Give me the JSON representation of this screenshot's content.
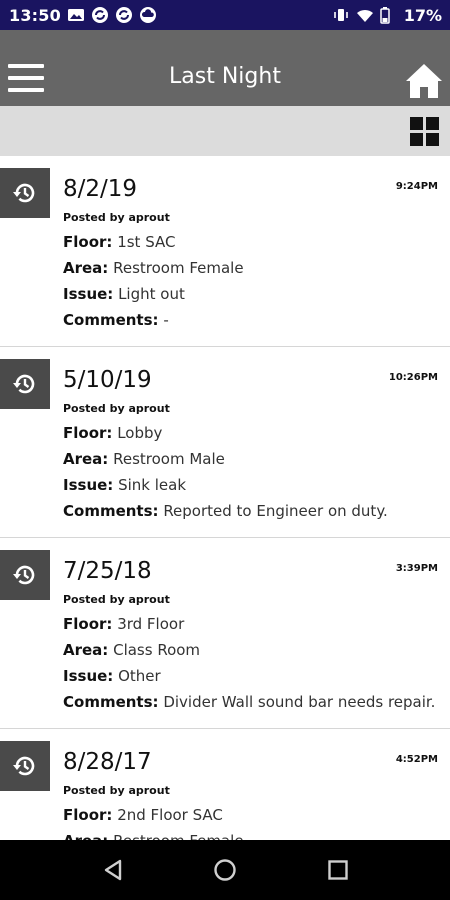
{
  "status": {
    "time": "13:50",
    "battery_percent": "17%",
    "left_icons": [
      "image-icon",
      "sync-icon",
      "sync-icon",
      "cloud-icon"
    ],
    "right_icons": [
      "vibrate-icon",
      "wifi-icon",
      "battery-icon"
    ]
  },
  "header": {
    "title": "Last Night",
    "menu_icon": "hamburger-menu-icon",
    "home_icon": "home-icon"
  },
  "toolbar": {
    "view_icon": "grid-view-icon"
  },
  "labels": {
    "floor": "Floor:",
    "area": "Area:",
    "issue": "Issue:",
    "comments": "Comments:"
  },
  "entries": [
    {
      "date": "8/2/19",
      "time": "9:24PM",
      "posted_by": "Posted by aprout",
      "floor": "1st SAC",
      "area": "Restroom Female",
      "issue": "Light out",
      "comments": "-"
    },
    {
      "date": "5/10/19",
      "time": "10:26PM",
      "posted_by": "Posted by aprout",
      "floor": "Lobby",
      "area": "Restroom Male",
      "issue": "Sink leak",
      "comments": "Reported to Engineer on duty."
    },
    {
      "date": "7/25/18",
      "time": "3:39PM",
      "posted_by": "Posted by aprout",
      "floor": "3rd Floor",
      "area": "Class Room",
      "issue": "Other",
      "comments": "Divider Wall sound bar needs repair."
    },
    {
      "date": "8/28/17",
      "time": "4:52PM",
      "posted_by": "Posted by aprout",
      "floor": "2nd Floor SAC",
      "area": "Restroom Female",
      "issue": "",
      "comments": ""
    }
  ],
  "nav": {
    "back_icon": "back-icon",
    "home_icon": "home-circle-icon",
    "recents_icon": "recents-icon"
  },
  "colors": {
    "status_bar": "#1a1460",
    "app_bar": "#666666",
    "toolbar": "#dcdcdc",
    "entry_icon_bg": "#4a4a4a"
  }
}
